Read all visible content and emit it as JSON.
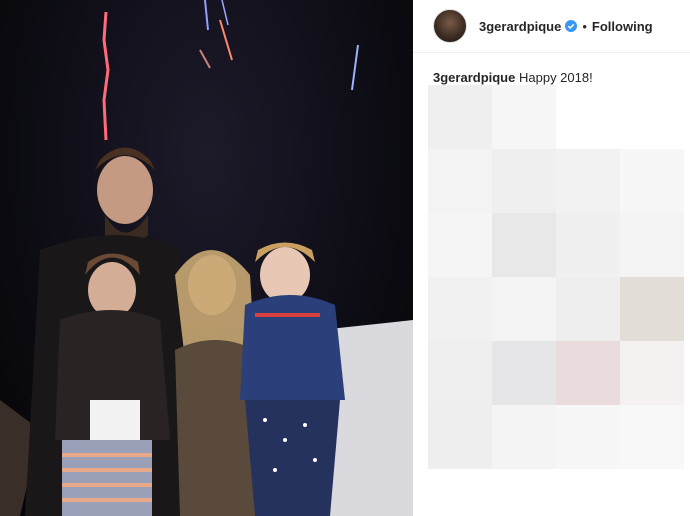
{
  "post": {
    "username": "3gerardpique",
    "follow_status": "Following",
    "separator": "•",
    "caption_user": "3gerardpique",
    "caption_text": "Happy 2018!"
  },
  "icons": {
    "avatar": "profile-avatar",
    "verified": "verified-badge-icon"
  },
  "colors": {
    "verified_blue": "#3897f0",
    "text": "#262626"
  }
}
